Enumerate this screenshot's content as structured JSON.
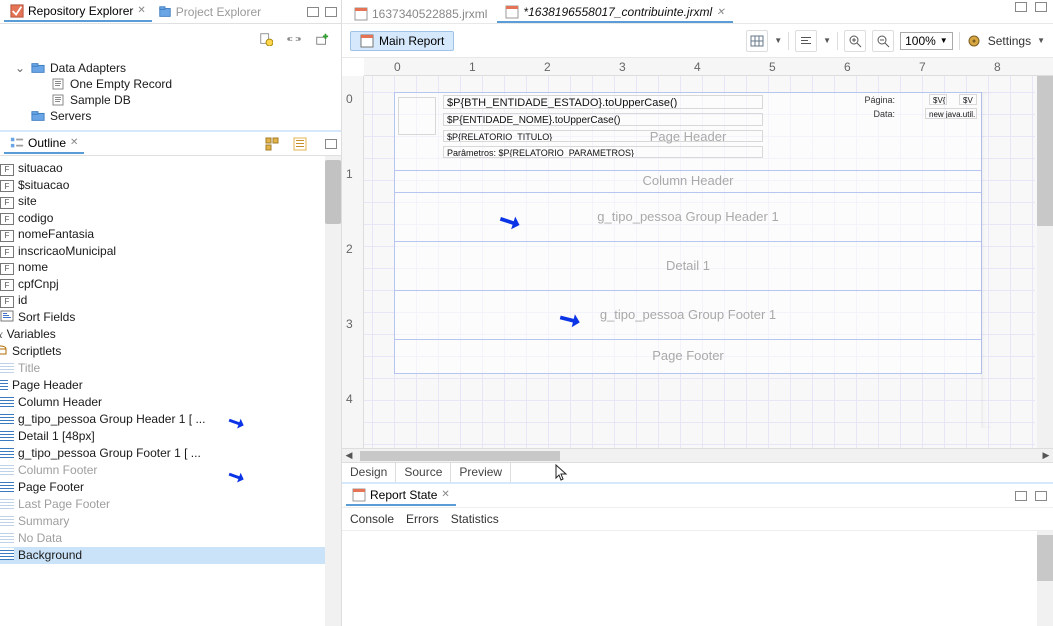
{
  "repo": {
    "tab_active": "Repository Explorer",
    "tab_inactive": "Project Explorer",
    "nodes": {
      "data_adapters": "Data Adapters",
      "one_empty": "One Empty Record",
      "sample_db": "Sample DB",
      "servers": "Servers"
    }
  },
  "outline": {
    "title": "Outline",
    "items": {
      "situacao": "situacao",
      "sSituacao": "$situacao",
      "site": "site",
      "codigo": "codigo",
      "nomeFantasia": "nomeFantasia",
      "inscricaoMunicipal": "inscricaoMunicipal",
      "nome": "nome",
      "cpfCnpj": "cpfCnpj",
      "id": "id",
      "sort_fields": "Sort Fields",
      "variables": "Variables",
      "scriptlets": "Scriptlets",
      "title_band": "Title",
      "page_header": "Page Header",
      "column_header": "Column Header",
      "g_header": "g_tipo_pessoa Group Header 1 [ ...",
      "detail": "Detail 1 [48px]",
      "g_footer": "g_tipo_pessoa Group Footer 1 [ ...",
      "column_footer": "Column Footer",
      "page_footer": "Page Footer",
      "last_page_footer": "Last Page Footer",
      "summary": "Summary",
      "no_data": "No Data",
      "background": "Background"
    }
  },
  "editor": {
    "tab1": "1637340522885.jrxml",
    "tab2": "*1638196558017_contribuinte.jrxml",
    "main_report": "Main Report",
    "zoom": "100%",
    "settings": "Settings"
  },
  "ruler_h": [
    "0",
    "1",
    "2",
    "3",
    "4",
    "5",
    "6",
    "7",
    "8"
  ],
  "ruler_v": [
    "0",
    "1",
    "2",
    "3",
    "4"
  ],
  "bands": {
    "page_header": "Page Header",
    "column_header": "Column Header",
    "group_header": "g_tipo_pessoa Group Header 1",
    "detail": "Detail 1",
    "group_footer": "g_tipo_pessoa Group Footer 1",
    "page_footer": "Page Footer"
  },
  "ph_fields": {
    "estado": "$P{BTH_ENTIDADE_ESTADO}.toUpperCase()",
    "nome": "$P{ENTIDADE_NOME}.toUpperCase()",
    "titulo": "$P{RELATORIO_TITULO}",
    "params": "Parâmetros: $P{RELATORIO_PARAMETROS}",
    "pagina": "Página:",
    "pagv1": "$V{",
    "pagv2": "$V",
    "data": "Data:",
    "datav": "new java.util."
  },
  "bottom_tabs": {
    "design": "Design",
    "source": "Source",
    "preview": "Preview"
  },
  "report_state": {
    "title": "Report State",
    "console": "Console",
    "errors": "Errors",
    "stats": "Statistics"
  },
  "chart_data": null
}
